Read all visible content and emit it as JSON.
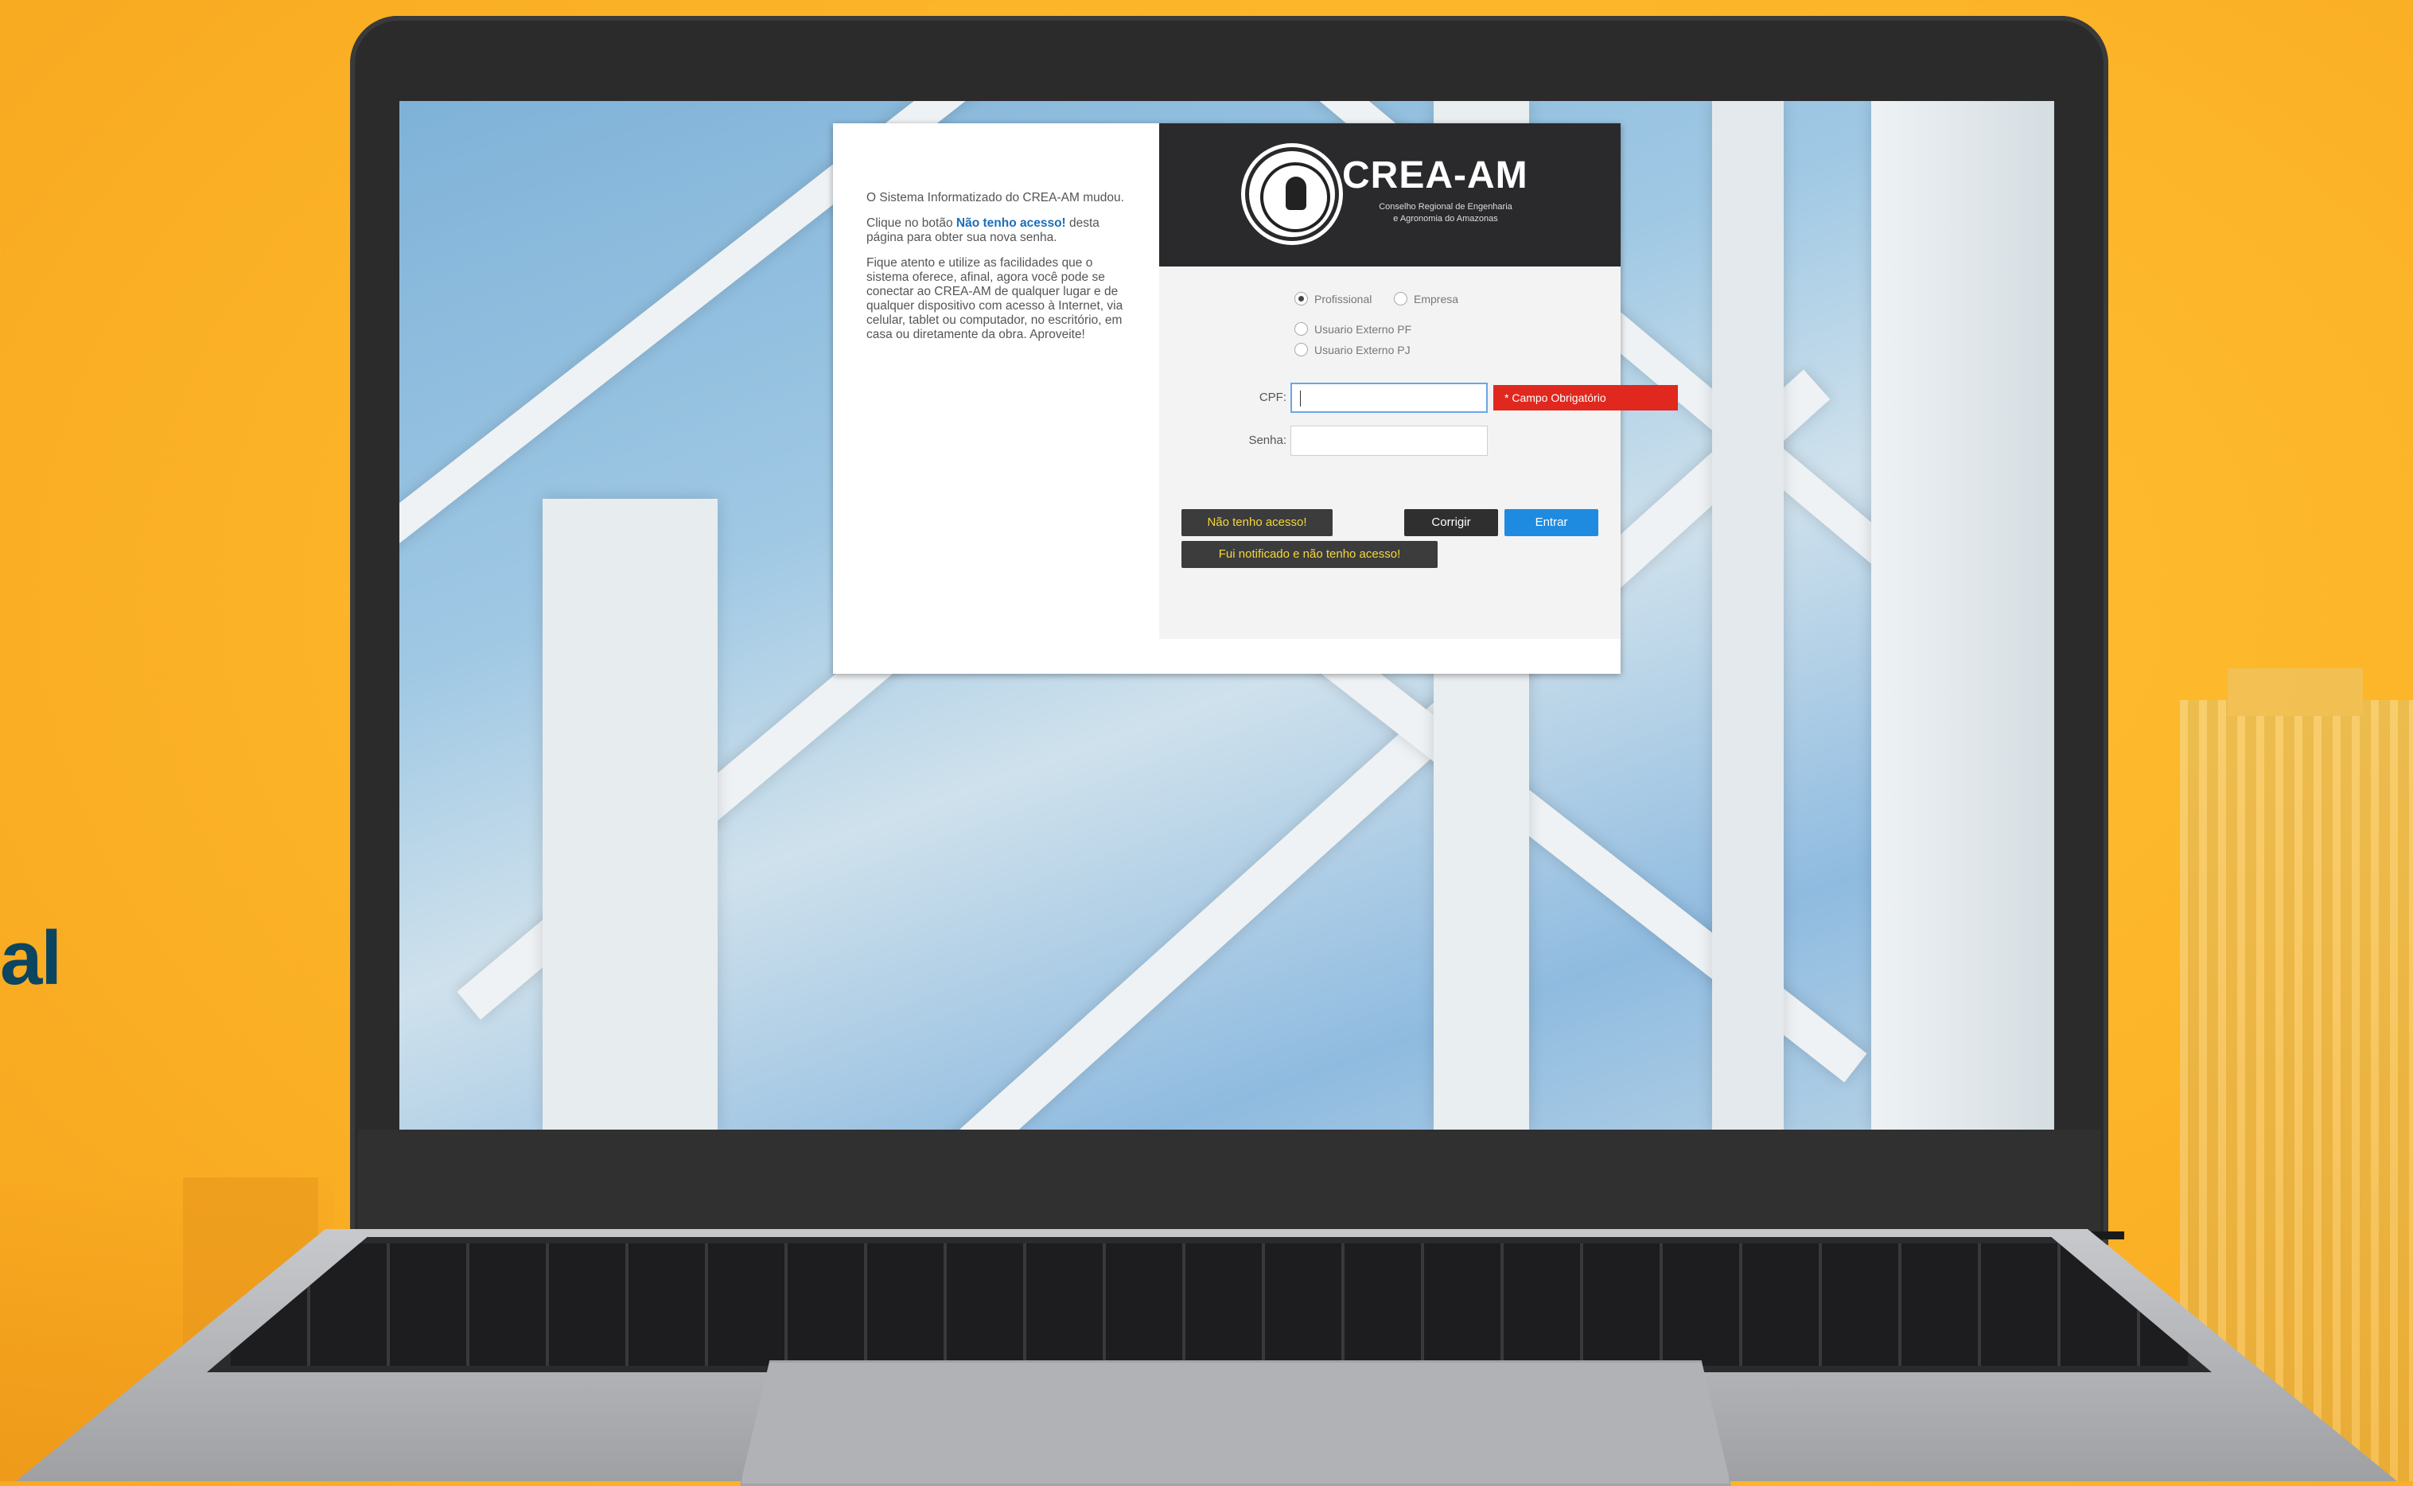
{
  "background": {
    "side_text": "al"
  },
  "dialog": {
    "info": {
      "paragraph1": "O Sistema Informatizado do CREA-AM mudou.",
      "paragraph2_pre": "Clique no botão ",
      "paragraph2_link": "Não tenho acesso!",
      "paragraph2_post": " desta página para obter sua nova senha.",
      "paragraph3": "Fique atento e utilize as facilidades que o sistema oferece, afinal, agora você pode se conectar ao CREA-AM de qualquer lugar e de qualquer dispositivo com acesso à Internet, via celular, tablet ou computador, no escritório, em casa ou diretamente da obra. Aproveite!"
    },
    "header": {
      "brand": "CREA-AM",
      "subtitle_line1": "Conselho Regional de Engenharia",
      "subtitle_line2": "e Agronomia do Amazonas"
    },
    "user_type": {
      "options": [
        "Profissional",
        "Empresa",
        "Usuario Externo PF",
        "Usuario Externo PJ"
      ],
      "selected": "Profissional"
    },
    "fields": {
      "cpf_label": "CPF:",
      "cpf_value": "",
      "cpf_error": "* Campo Obrigatório",
      "senha_label": "Senha:",
      "senha_value": ""
    },
    "buttons": {
      "no_access": "Não tenho acesso!",
      "corrigir": "Corrigir",
      "entrar": "Entrar",
      "notified_no_access": "Fui notificado e não tenho acesso!"
    }
  }
}
